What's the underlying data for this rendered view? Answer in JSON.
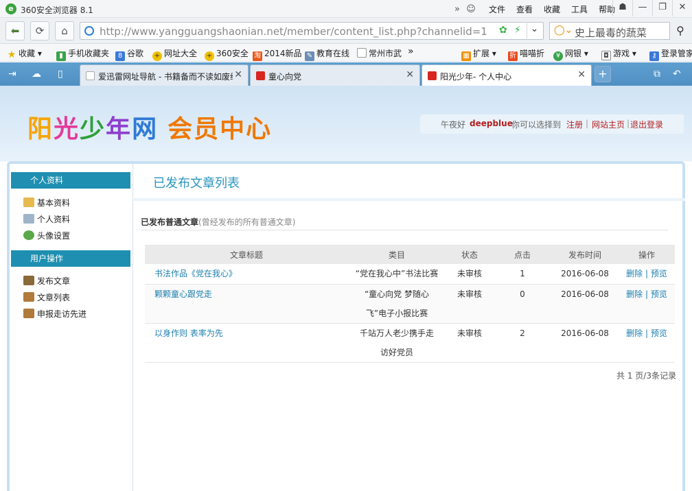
{
  "browser": {
    "title": "360安全浏览器 8.1",
    "menu": [
      "文件",
      "查看",
      "收藏",
      "工具",
      "帮助"
    ],
    "url_domain": "http://www.yangguangshaonian.net",
    "url_path": "/member/content_list.php?channelid=1",
    "search_placeholder": "史上最毒的蔬菜",
    "bookmarks": [
      "收藏",
      "手机收藏夹",
      "谷歌",
      "网址大全",
      "360安全",
      "2014新品",
      "教育在线",
      "常州市武",
      "扩展",
      "喵喵折",
      "网银",
      "游戏",
      "登录管家"
    ],
    "tabs": [
      {
        "title": "爱迅雷网址导航 - 书籍备而不读如废纸"
      },
      {
        "title": "童心向党"
      },
      {
        "title": "阳光少年- 个人中心"
      }
    ]
  },
  "header": {
    "logo_site": [
      "阳",
      "光",
      "少",
      "年",
      "网"
    ],
    "logo_member": "会员中心",
    "greeting": "午夜好",
    "username": "deepblue",
    "choose_text": "你可以选择到",
    "links": [
      "注册",
      "网站主页",
      "退出登录"
    ]
  },
  "sidebar": {
    "section1": "个人资料",
    "items1": [
      "基本资料",
      "个人资料",
      "头像设置"
    ],
    "section2": "用户操作",
    "items2": [
      "发布文章",
      "文章列表",
      "申报走访先进"
    ]
  },
  "main": {
    "title": "已发布文章列表",
    "subtitle_bold": "已发布普通文章",
    "subtitle_note": "(曾经发布的所有普通文章)",
    "columns": [
      "文章标题",
      "类目",
      "状态",
      "点击",
      "发布时间",
      "操作"
    ],
    "rows": [
      {
        "title": "书法作品《党在我心》",
        "category": [
          "“党在我心中”书法比赛"
        ],
        "status": "未审核",
        "clicks": "1",
        "date": "2016-06-08",
        "delete": "删除",
        "preview": "预览"
      },
      {
        "title": "颗颗童心跟党走",
        "category": [
          "“童心向党 梦随心",
          "飞”电子小报比赛"
        ],
        "status": "未审核",
        "clicks": "0",
        "date": "2016-06-08",
        "delete": "删除",
        "preview": "预览"
      },
      {
        "title": "以身作则 表率为先",
        "category": [
          "千站万人老少携手走",
          "访好党员"
        ],
        "status": "未审核",
        "clicks": "2",
        "date": "2016-06-08",
        "delete": "删除",
        "preview": "预览"
      }
    ],
    "pager": "共 1 页/3条记录"
  }
}
